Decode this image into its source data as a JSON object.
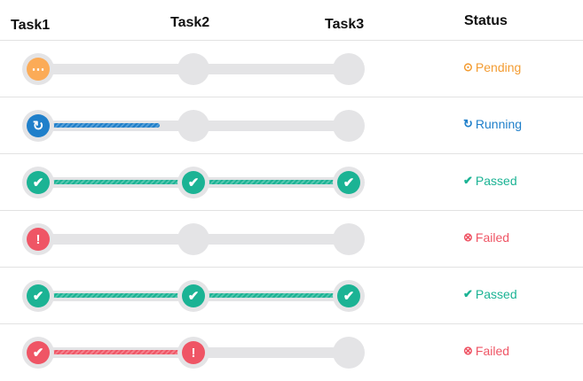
{
  "header": {
    "task1": "Task1",
    "task2": "Task2",
    "task3": "Task3",
    "status": "Status"
  },
  "colors": {
    "pending": "#fbab57",
    "running": "#1f7fca",
    "passed": "#1bb394",
    "failed": "#ef5565",
    "track": "#e4e4e6",
    "pending_text": "#f39c32"
  },
  "icons": {
    "pending": "ellipsis-circle-icon",
    "running": "refresh-icon",
    "passed": "check-icon",
    "failed": "exclamation-icon"
  },
  "rows": [
    {
      "nodes": [
        "pending",
        "none",
        "none"
      ],
      "connectors": [
        {
          "state": "none",
          "progress": 0
        },
        {
          "state": "none",
          "progress": 0
        }
      ],
      "status": {
        "state": "pending",
        "label": "Pending"
      }
    },
    {
      "nodes": [
        "running",
        "none",
        "none"
      ],
      "connectors": [
        {
          "state": "running",
          "progress": 0.78
        },
        {
          "state": "none",
          "progress": 0
        }
      ],
      "status": {
        "state": "running",
        "label": "Running"
      }
    },
    {
      "nodes": [
        "passed",
        "passed",
        "passed"
      ],
      "connectors": [
        {
          "state": "passed",
          "progress": 1
        },
        {
          "state": "passed",
          "progress": 1
        }
      ],
      "status": {
        "state": "passed",
        "label": "Passed"
      }
    },
    {
      "nodes": [
        "failed",
        "none",
        "none"
      ],
      "connectors": [
        {
          "state": "none",
          "progress": 0
        },
        {
          "state": "none",
          "progress": 0
        }
      ],
      "status": {
        "state": "failed",
        "label": "Failed"
      }
    },
    {
      "nodes": [
        "passed",
        "passed",
        "passed"
      ],
      "connectors": [
        {
          "state": "passed",
          "progress": 1
        },
        {
          "state": "passed",
          "progress": 1
        }
      ],
      "status": {
        "state": "passed",
        "label": "Passed"
      }
    },
    {
      "nodes": [
        "failed-passed",
        "failed",
        "none"
      ],
      "connectors": [
        {
          "state": "failed",
          "progress": 1
        },
        {
          "state": "none",
          "progress": 0
        }
      ],
      "status": {
        "state": "failed",
        "label": "Failed"
      }
    }
  ]
}
